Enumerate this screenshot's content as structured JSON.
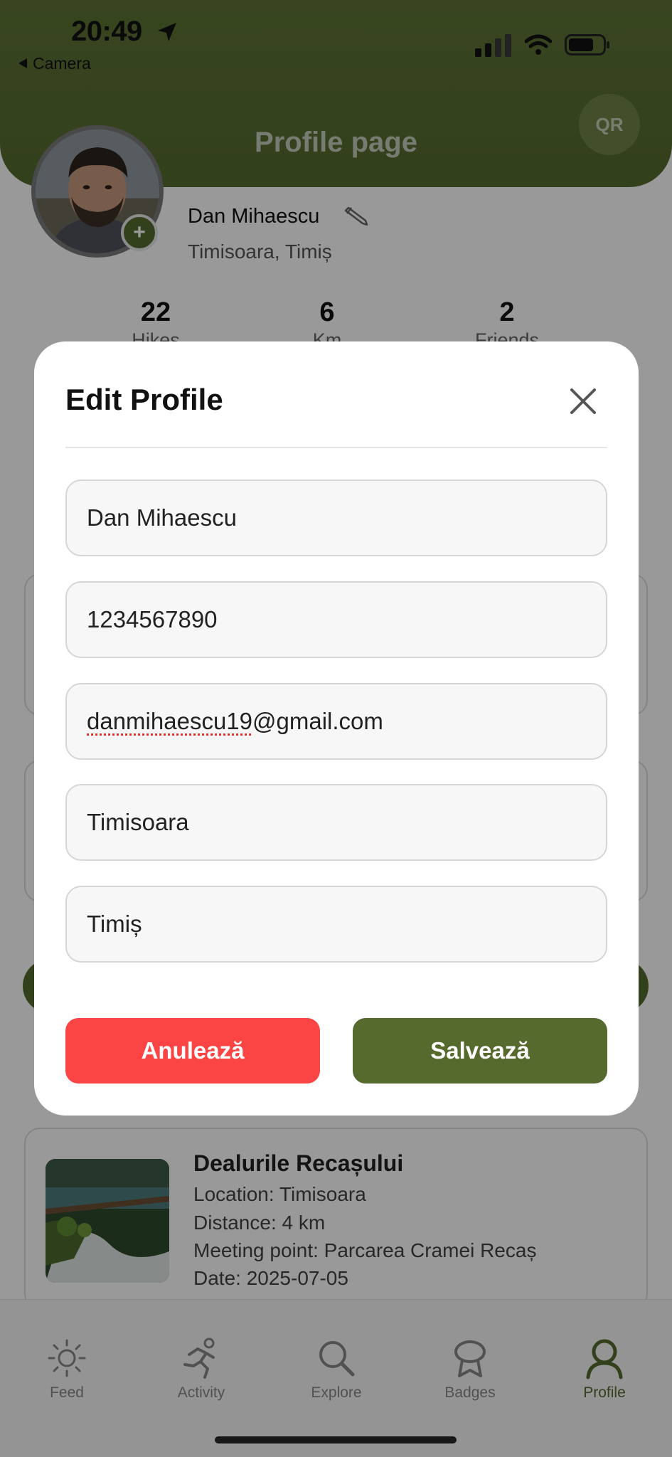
{
  "status_bar": {
    "time": "20:49",
    "back_label": "Camera"
  },
  "header": {
    "title": "Profile page",
    "qr_label": "QR"
  },
  "profile": {
    "name": "Dan Mihaescu",
    "location": "Timisoara, Timiș",
    "add_symbol": "+"
  },
  "stats": [
    {
      "value": "22",
      "label": "Hikes"
    },
    {
      "value": "6",
      "label": "Km"
    },
    {
      "value": "2",
      "label": "Friends"
    }
  ],
  "hike_card": {
    "title": "Dealurile Recașului",
    "location": "Location: Timisoara",
    "distance": "Distance: 4 km",
    "meeting_point": "Meeting point: Parcarea Cramei Recaș",
    "date": "Date: 2025-07-05"
  },
  "tabs": [
    {
      "label": "Feed",
      "icon": "sun-icon"
    },
    {
      "label": "Activity",
      "icon": "runner-icon"
    },
    {
      "label": "Explore",
      "icon": "search-icon"
    },
    {
      "label": "Badges",
      "icon": "badge-icon"
    },
    {
      "label": "Profile",
      "icon": "user-icon",
      "active": true
    }
  ],
  "modal": {
    "title": "Edit Profile",
    "fields": {
      "name": "Dan Mihaescu",
      "phone": "1234567890",
      "email_user": "danmihaescu19",
      "email_domain": "@gmail.com",
      "city": "Timisoara",
      "county": "Timiș"
    },
    "cancel_label": "Anulează",
    "save_label": "Salvează"
  },
  "colors": {
    "brand_green": "#556b2f",
    "cancel_red": "#fb4444",
    "save_green": "#566a2e"
  }
}
